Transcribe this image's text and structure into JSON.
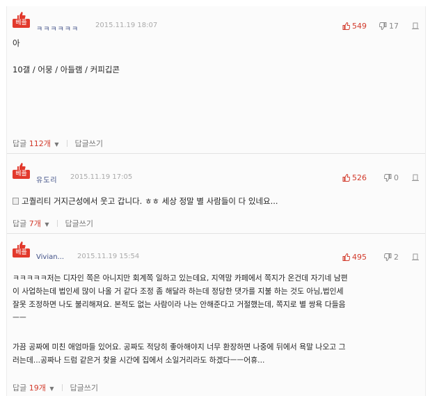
{
  "comments": [
    {
      "badge": "베플",
      "author": "ㅋㅋㅋㅋㅋㅋ",
      "date": "2015.11.19 18:07",
      "likes": "549",
      "dislikes": "17",
      "lines": [
        "아",
        "",
        "10갤 / 어뭉 / 아들램 / 커피깁콘"
      ],
      "reply_label": "답글",
      "reply_count": "112개",
      "write_reply": "답글쓰기"
    },
    {
      "badge": "베플",
      "author": "유도리",
      "date": "2015.11.19 17:05",
      "likes": "526",
      "dislikes": "0",
      "lines": [
        "고퀄리티 거지근성에서 웃고 갑니다. ㅎㅎ 세상 정말 별 사람들이 다 있네요..."
      ],
      "reply_label": "답글",
      "reply_count": "7개",
      "write_reply": "답글쓰기"
    },
    {
      "badge": "베플",
      "author": "Vivian...",
      "date": "2015.11.19 15:54",
      "likes": "495",
      "dislikes": "2",
      "lines": [
        "ㅋㅋㅋㅋㅋ저는 디자인 쪽은 아니지만 회계쪽 일하고 있는데요, 지역맘 카페에서 쪽지가 온건데 자기네 남편",
        "이 사업하는데 법인세 많이 나올 거 같다 조정 좀 해달라 하는데 정당한 댓가를 지불 하는 것도 아님,법인세",
        "잘못 조정하면 나도 불리해져요. 본적도 없는 사람이라 나는 안해준다고 거절했는데, 쪽지로 별 쌍욕 다들음",
        "ㅡㅡ",
        "",
        "가끔 공짜에 미친 애엄마들 있어요. 공짜도 적당히 좋아해야지 너무 환장하면 나중에 뒤에서 욕말 나오고 그",
        "러는데...공짜나 드럼 같은거 찾을 시간에 집에서 소일거리라도 하겠다ㅡㅡ어휴..."
      ],
      "reply_label": "답글",
      "reply_count": "19개",
      "write_reply": "답글쓰기"
    }
  ]
}
